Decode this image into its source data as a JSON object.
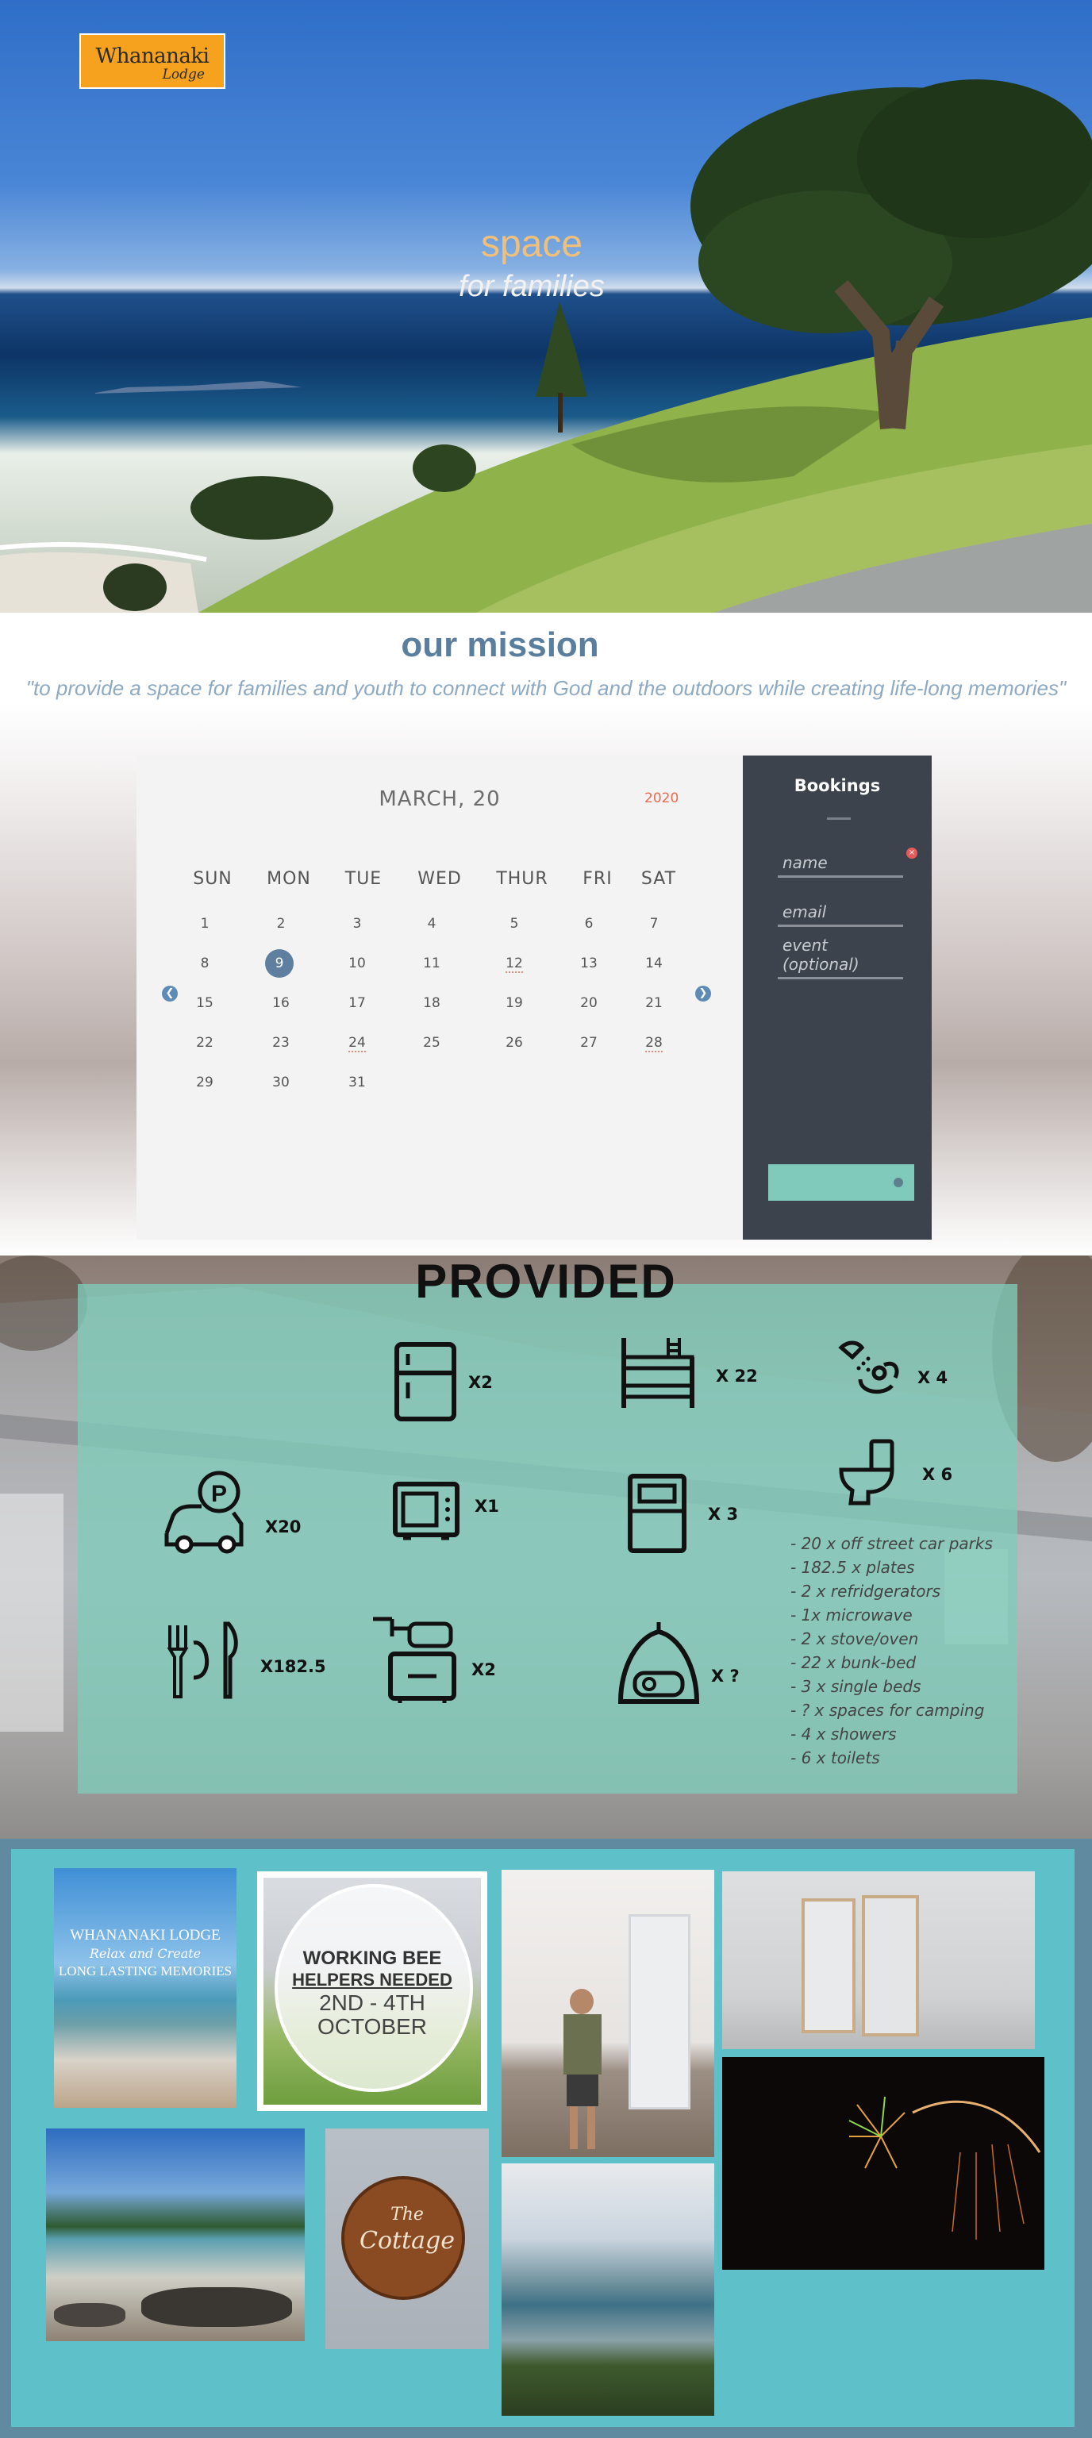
{
  "hero": {
    "logo_line1": "Whananaki",
    "logo_line2": "Lodge",
    "tagline_main": "space",
    "tagline_sub": "for families"
  },
  "mission": {
    "title": "our mission",
    "quote": "\"to provide a space for families and youth to connect with God and the outdoors while creating life-long memories\""
  },
  "calendar": {
    "month_label": "MARCH, 20",
    "year_label": "2020",
    "weekdays": [
      "SUN",
      "MON",
      "TUE",
      "WED",
      "THUR",
      "FRI",
      "SAT"
    ],
    "weeks": [
      [
        "1",
        "2",
        "3",
        "4",
        "5",
        "6",
        "7"
      ],
      [
        "8",
        "9",
        "10",
        "11",
        "12",
        "13",
        "14"
      ],
      [
        "15",
        "16",
        "17",
        "18",
        "19",
        "20",
        "21"
      ],
      [
        "22",
        "23",
        "24",
        "25",
        "26",
        "27",
        "28"
      ],
      [
        "29",
        "30",
        "31",
        "",
        "",
        "",
        ""
      ]
    ],
    "selected_day": "9",
    "prev_icon": "chevron-left-icon",
    "next_icon": "chevron-right-icon"
  },
  "bookings": {
    "title": "Bookings",
    "name_placeholder": "name",
    "email_placeholder": "email",
    "event_placeholder": "event (optional)",
    "submit_label": ""
  },
  "provided": {
    "title": "PROVIDED",
    "items": [
      {
        "icon": "refrigerator-icon",
        "count": "X2"
      },
      {
        "icon": "bunk-bed-icon",
        "count": "X 22"
      },
      {
        "icon": "shower-icon",
        "count": "X 4"
      },
      {
        "icon": "toilet-icon",
        "count": "X 6"
      },
      {
        "icon": "parking-car-icon",
        "count": "X20"
      },
      {
        "icon": "microwave-icon",
        "count": "X1"
      },
      {
        "icon": "single-bed-icon",
        "count": "X 3"
      },
      {
        "icon": "plate-cutlery-icon",
        "count": "X182.5"
      },
      {
        "icon": "stove-oven-icon",
        "count": "X2"
      },
      {
        "icon": "tent-camping-icon",
        "count": "X ?"
      }
    ],
    "list": [
      "- 20 x off street car parks",
      "- 182.5 x plates",
      "- 2 x refridgerators",
      "- 1x microwave",
      "- 2 x stove/oven",
      "- 22 x bunk-bed",
      "- 3 x single beds",
      "- ? x spaces for camping",
      "- 4 x showers",
      "- 6 x toilets"
    ]
  },
  "gallery": {
    "photo1_text": [
      "WHANANAKI LODGE",
      "Relax and Create",
      "LONG LASTING MEMORIES"
    ],
    "photo2_text": [
      "WORKING BEE",
      "HELPERS NEEDED",
      "2ND - 4TH",
      "OCTOBER"
    ],
    "photo_cottage_text": [
      "The",
      "Cottage"
    ]
  },
  "colors": {
    "accent_teal": "#7fcabb",
    "mission_blue": "#5a7f9e",
    "year_orange": "#ea6b4d",
    "bookings_dark": "#3d434c",
    "gallery_bg": "#5ec0c8"
  }
}
